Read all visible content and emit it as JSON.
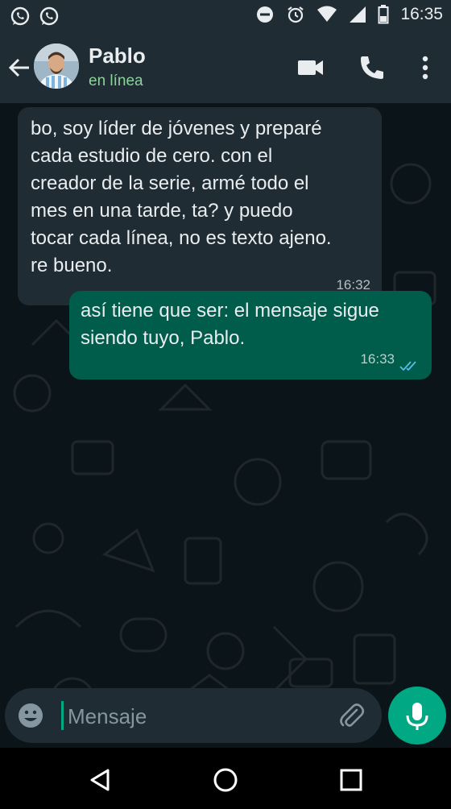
{
  "status_bar": {
    "time": "16:35",
    "left_icons": [
      "whatsapp-icon",
      "whatsapp-icon"
    ],
    "right_icons": [
      "do-not-disturb-icon",
      "alarm-icon",
      "wifi-icon",
      "cellular-signal-icon",
      "battery-icon"
    ]
  },
  "header": {
    "contact_name": "Pablo",
    "contact_status": "en línea",
    "actions": [
      "video-call-icon",
      "voice-call-icon",
      "more-options-icon"
    ]
  },
  "messages": [
    {
      "direction": "incoming",
      "text": "bo, soy líder de jóvenes y preparé\ncada estudio de cero. con el\ncreador de la serie, armé todo el\nmes en una tarde, ta? y puedo\ntocar cada línea, no es texto ajeno.\nre bueno.",
      "time": "16:32"
    },
    {
      "direction": "outgoing",
      "text": "así tiene que ser: el mensaje sigue\nsiendo tuyo, Pablo.",
      "time": "16:33",
      "read": true
    }
  ],
  "composer": {
    "placeholder": "Mensaje",
    "value": ""
  },
  "colors": {
    "header_bg": "#1f2c33",
    "chat_bg": "#0b1418",
    "incoming_bubble": "#202c33",
    "outgoing_bubble": "#005c4b",
    "accent": "#00a884",
    "online_text": "#8ed19c",
    "read_ticks": "#53bdeb"
  }
}
